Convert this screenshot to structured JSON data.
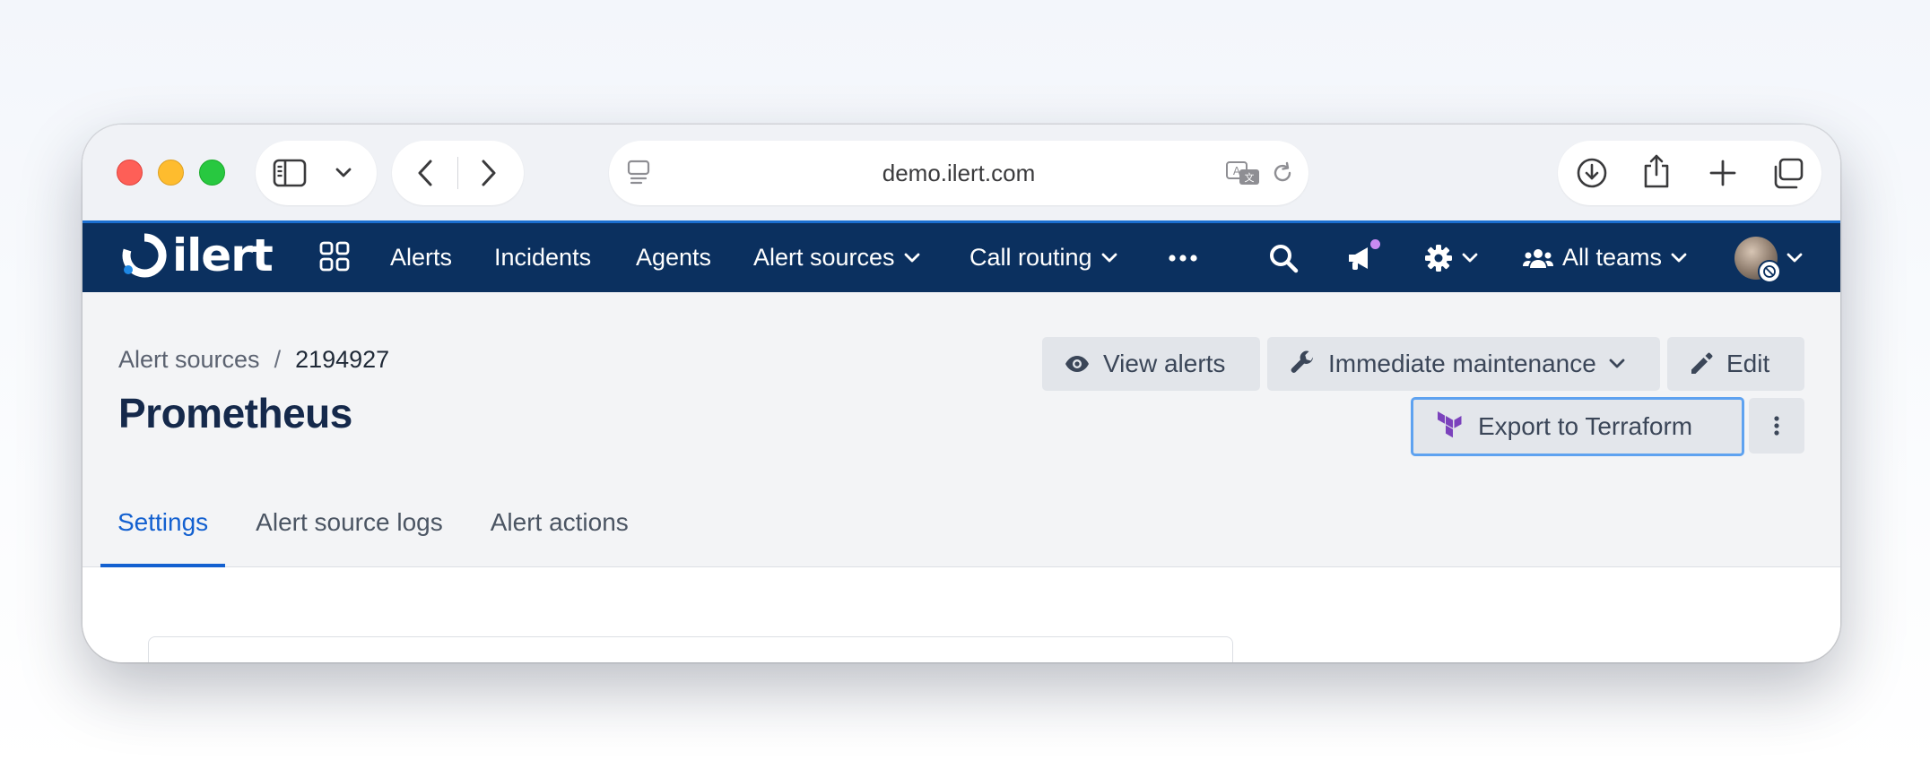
{
  "browser": {
    "url": "demo.ilert.com"
  },
  "navbar": {
    "logo_text": "ilert",
    "items": [
      {
        "label": "Alerts"
      },
      {
        "label": "Incidents"
      },
      {
        "label": "Agents"
      },
      {
        "label": "Alert sources"
      },
      {
        "label": "Call routing"
      }
    ],
    "teams_label": "All teams",
    "notification_color": "#c98bf2"
  },
  "page": {
    "breadcrumb": {
      "parent": "Alert sources",
      "separator": "/",
      "current": "2194927"
    },
    "title": "Prometheus",
    "buttons": {
      "view_alerts": "View alerts",
      "immediate_maintenance": "Immediate maintenance",
      "edit": "Edit",
      "export_terraform": "Export to Terraform"
    },
    "tabs": [
      {
        "label": "Settings",
        "active": true
      },
      {
        "label": "Alert source logs",
        "active": false
      },
      {
        "label": "Alert actions",
        "active": false
      }
    ]
  },
  "colors": {
    "navbar_bg": "#0b305f",
    "accent": "#1360d0",
    "terraform": "#7b42bc"
  }
}
